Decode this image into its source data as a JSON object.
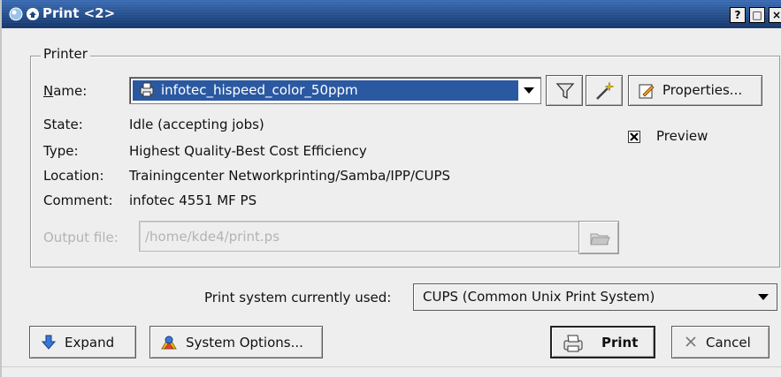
{
  "window": {
    "title": "Print <2>",
    "controls": {
      "help": "?",
      "maximize": "□",
      "close": "×"
    }
  },
  "printer_group": {
    "title": "Printer",
    "name_label": "Name:",
    "name_value": "infotec_hispeed_color_50ppm",
    "state_label": "State:",
    "state_value": "Idle (accepting jobs)",
    "type_label": "Type:",
    "type_value": "Highest Quality-Best Cost Efficiency",
    "location_label": "Location:",
    "location_value": "Trainingcenter Networkprinting/Samba/IPP/CUPS",
    "comment_label": "Comment:",
    "comment_value": "infotec 4551 MF PS",
    "output_label": "Output file:",
    "output_value": "/home/kde4/print.ps",
    "properties_label": "Properties...",
    "preview_label": "Preview",
    "preview_checked": true
  },
  "print_system": {
    "label": "Print system currently used:",
    "value": "CUPS (Common Unix Print System)"
  },
  "buttons": {
    "expand": "Expand",
    "system_options": "System Options...",
    "print": "Print",
    "cancel": "Cancel"
  },
  "colors": {
    "titlebar": "#1c4680",
    "selection": "#2a59a2",
    "window_bg": "#eeeeee"
  }
}
